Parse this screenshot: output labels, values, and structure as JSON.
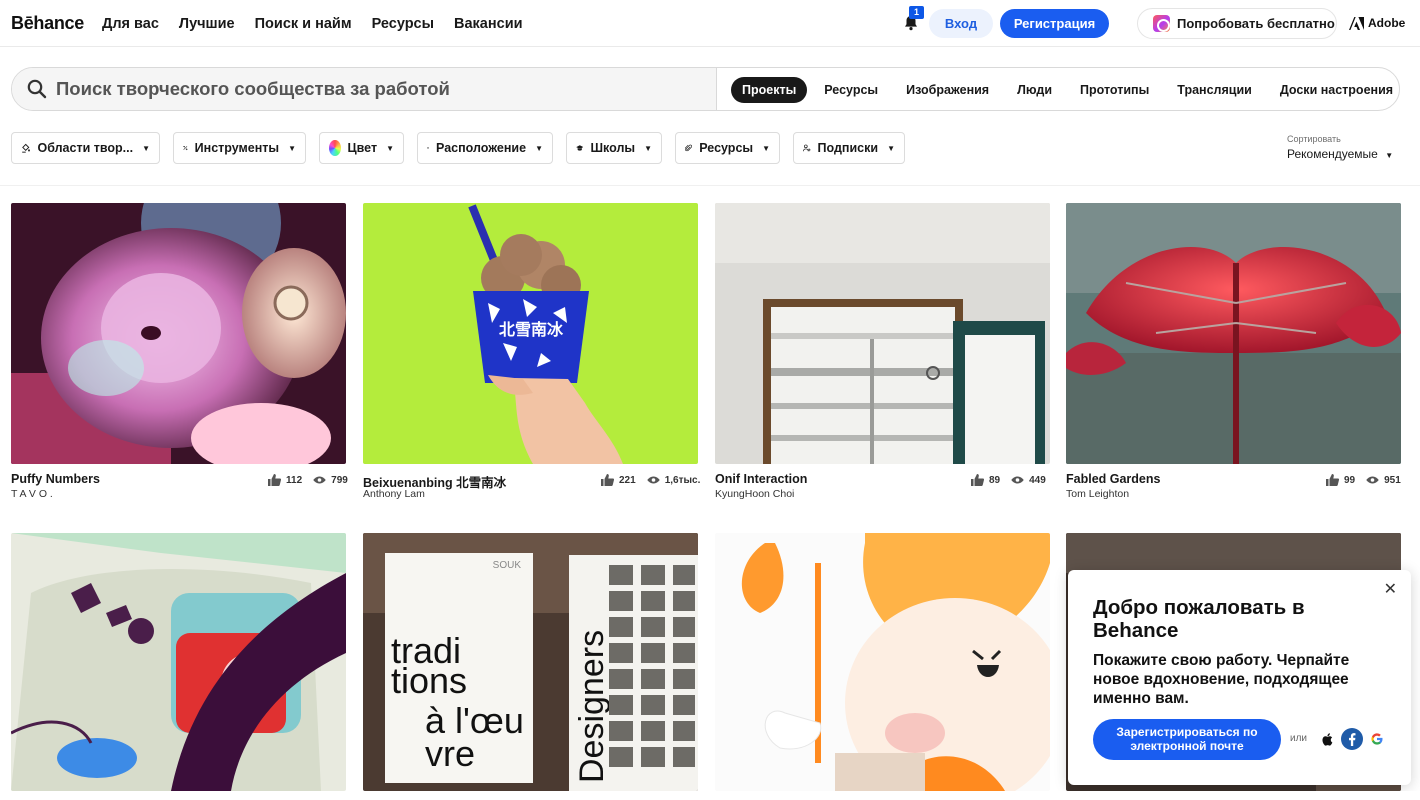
{
  "brand": {
    "logo": "Bēhance",
    "adobe": "Adobe"
  },
  "nav": {
    "links": [
      "Для вас",
      "Лучшие",
      "Поиск и найм",
      "Ресурсы",
      "Вакансии"
    ],
    "notification_count": "1",
    "login": "Вход",
    "signup": "Регистрация",
    "try_free": "Попробовать бесплатно"
  },
  "search": {
    "placeholder": "Поиск творческого сообщества за работой",
    "tabs": [
      "Проекты",
      "Ресурсы",
      "Изображения",
      "Люди",
      "Прототипы",
      "Трансляции",
      "Доски настроения"
    ],
    "active_tab": "Проекты"
  },
  "filters": {
    "items": [
      "Области твор...",
      "Инструменты",
      "Цвет",
      "Расположение",
      "Школы",
      "Ресурсы",
      "Подписки"
    ]
  },
  "sort": {
    "label": "Сортировать",
    "value": "Рекомендуемые"
  },
  "projects": [
    {
      "title": "Puffy Numbers",
      "owner": "T A V O .",
      "likes": "112",
      "views": "799"
    },
    {
      "title": "Beixuenanbing 北雪南冰",
      "owner": "Anthony Lam",
      "likes": "221",
      "views": "1,6тыс."
    },
    {
      "title": "Onif Interaction",
      "owner": "KyungHoon Choi",
      "likes": "89",
      "views": "449"
    },
    {
      "title": "Fabled Gardens",
      "owner": "Tom Leighton",
      "likes": "99",
      "views": "951"
    }
  ],
  "artwork_text": {
    "cup_brand": "北雪南冰",
    "poster_souk": "SOUK",
    "poster_line1": "tradi",
    "poster_line2": "tions",
    "poster_line3": "à l'œu",
    "poster_line4": "vre",
    "poster_designers": "Designers"
  },
  "popup": {
    "title": "Добро пожаловать в Behance",
    "text": "Покажите свою работу. Черпайте новое вдохновение, подходящее именно вам.",
    "cta": "Зарегистрироваться по электронной почте",
    "or": "или"
  },
  "colors": {
    "accent": "#1a5df0",
    "text": "#191919"
  }
}
